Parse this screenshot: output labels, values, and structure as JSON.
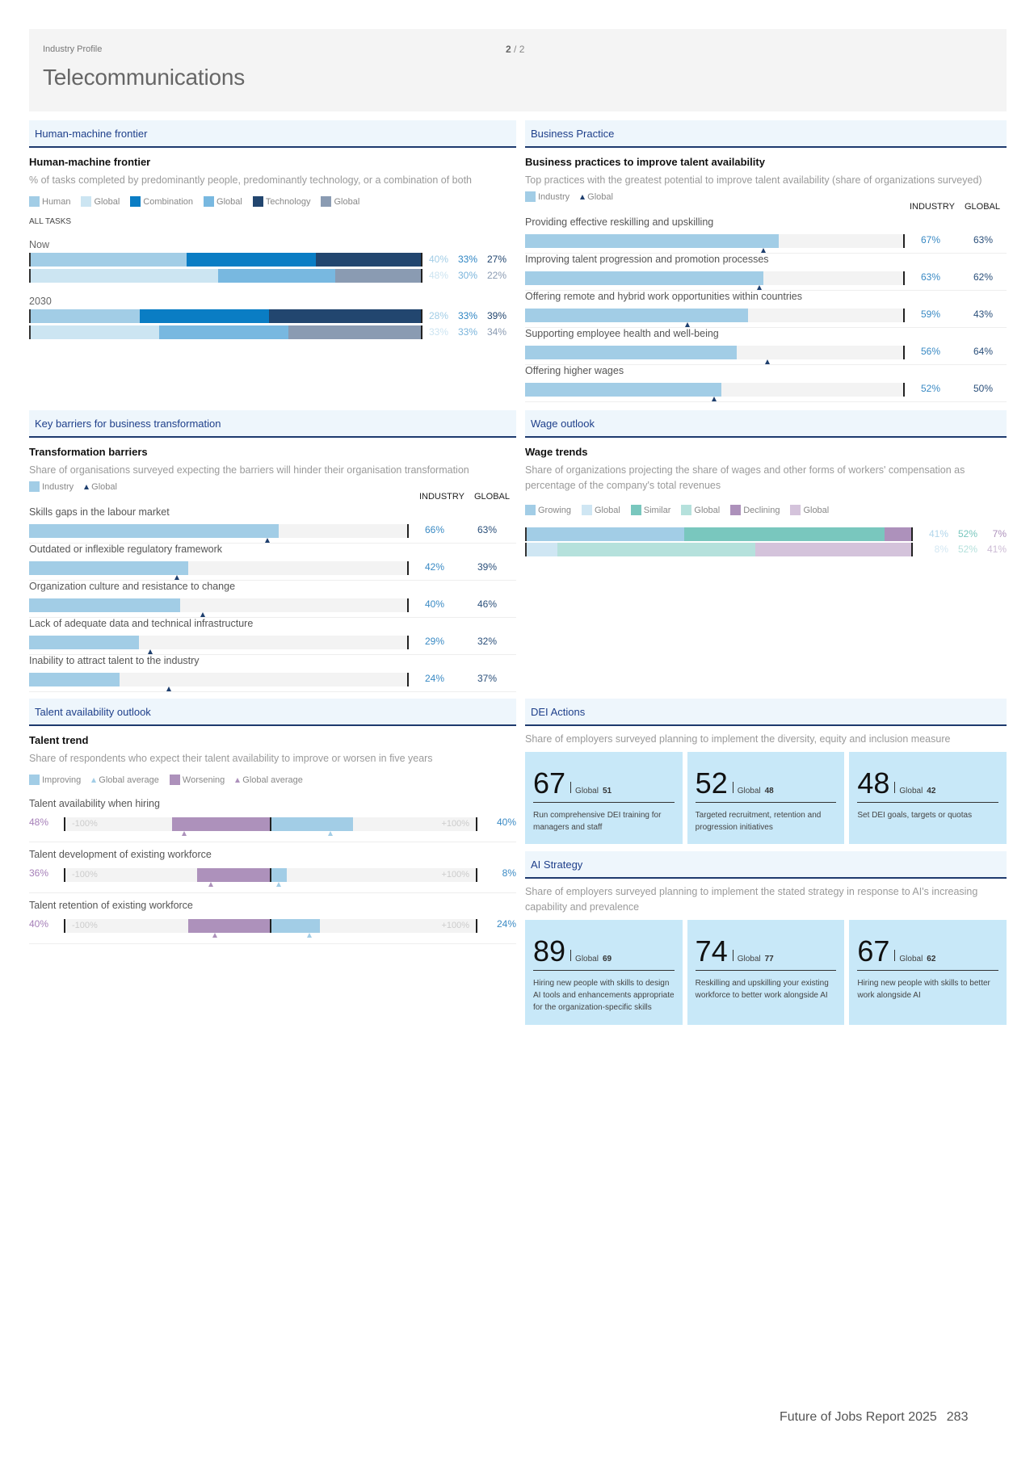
{
  "header": {
    "kicker": "Industry Profile",
    "page_current": "2",
    "page_sep": "/",
    "page_total": "2",
    "title": "Telecommunications"
  },
  "colors": {
    "human": "#a2cde6",
    "human_global": "#cce5f2",
    "combination": "#0a7dc4",
    "combination_global": "#78b8e0",
    "technology": "#22466f",
    "technology_global": "#8a9bb2",
    "growing": "#a2cde6",
    "growing_global": "#cfe6f3",
    "similar": "#79c7be",
    "similar_global": "#b5e1dc",
    "declining": "#ad91bb",
    "declining_global": "#d4c3db"
  },
  "hmf": {
    "section": "Human-machine frontier",
    "title": "Human-machine frontier",
    "desc": "% of tasks completed by predominantly people, predominantly technology, or a combination of both",
    "legend": [
      "Human",
      "Global",
      "Combination",
      "Global",
      "Technology",
      "Global"
    ],
    "tag": "ALL TASKS",
    "groups": [
      {
        "label": "Now",
        "industry": [
          40,
          33,
          27
        ],
        "global": [
          48,
          30,
          22
        ],
        "industry_text": [
          "40%",
          "33%",
          "27%"
        ],
        "global_text": [
          "48%",
          "30%",
          "22%"
        ]
      },
      {
        "label": "2030",
        "industry": [
          28,
          33,
          39
        ],
        "global": [
          33,
          33,
          34
        ],
        "industry_text": [
          "28%",
          "33%",
          "39%"
        ],
        "global_text": [
          "33%",
          "33%",
          "34%"
        ]
      }
    ]
  },
  "business": {
    "section": "Business Practice",
    "title": "Business practices to improve talent availability",
    "desc": "Top practices with the greatest potential to improve talent availability (share of organizations surveyed)",
    "legend_industry": "Industry",
    "legend_global": "Global",
    "col_industry": "INDUSTRY",
    "col_global": "GLOBAL",
    "items": [
      {
        "label": "Providing effective reskilling and upskilling",
        "industry": 67,
        "global": 63,
        "industry_text": "67%",
        "global_text": "63%"
      },
      {
        "label": "Improving talent progression and promotion processes",
        "industry": 63,
        "global": 62,
        "industry_text": "63%",
        "global_text": "62%"
      },
      {
        "label": "Offering remote and hybrid work opportunities within countries",
        "industry": 59,
        "global": 43,
        "industry_text": "59%",
        "global_text": "43%"
      },
      {
        "label": "Supporting employee health and well-being",
        "industry": 56,
        "global": 64,
        "industry_text": "56%",
        "global_text": "64%"
      },
      {
        "label": "Offering higher wages",
        "industry": 52,
        "global": 50,
        "industry_text": "52%",
        "global_text": "50%"
      }
    ]
  },
  "barriers": {
    "section": "Key barriers for business transformation",
    "title": "Transformation barriers",
    "desc": "Share of organisations surveyed expecting the barriers will hinder their organisation transformation",
    "legend_industry": "Industry",
    "legend_global": "Global",
    "col_industry": "INDUSTRY",
    "col_global": "GLOBAL",
    "items": [
      {
        "label": "Skills gaps in the labour market",
        "industry": 66,
        "global": 63,
        "industry_text": "66%",
        "global_text": "63%"
      },
      {
        "label": "Outdated or inflexible regulatory framework",
        "industry": 42,
        "global": 39,
        "industry_text": "42%",
        "global_text": "39%"
      },
      {
        "label": "Organization culture and resistance to change",
        "industry": 40,
        "global": 46,
        "industry_text": "40%",
        "global_text": "46%"
      },
      {
        "label": "Lack of adequate data and technical infrastructure",
        "industry": 29,
        "global": 32,
        "industry_text": "29%",
        "global_text": "32%"
      },
      {
        "label": "Inability to attract talent to the industry",
        "industry": 24,
        "global": 37,
        "industry_text": "24%",
        "global_text": "37%"
      }
    ]
  },
  "wage": {
    "section": "Wage outlook",
    "title": "Wage trends",
    "desc": "Share of organizations projecting the share of wages and other forms of workers' compensation as percentage of the company's total revenues",
    "legend": [
      "Growing",
      "Global",
      "Similar",
      "Global",
      "Declining",
      "Global"
    ],
    "industry": [
      41,
      52,
      7
    ],
    "global": [
      8,
      52,
      41
    ],
    "industry_text": [
      "41%",
      "52%",
      "7%"
    ],
    "global_text": [
      "8%",
      "52%",
      "41%"
    ]
  },
  "talent": {
    "section": "Talent availability outlook",
    "title": "Talent trend",
    "desc": "Share of respondents who expect their talent availability to improve or worsen in five years",
    "legend": [
      "Improving",
      "Global average",
      "Worsening",
      "Global average"
    ],
    "axis_min": "-100%",
    "axis_max": "+100%",
    "items": [
      {
        "label": "Talent availability when hiring",
        "worsening": 48,
        "improving": 40,
        "worsening_global": 42,
        "improving_global": 29,
        "worsening_text": "48%",
        "improving_text": "40%"
      },
      {
        "label": "Talent development of existing workforce",
        "worsening": 36,
        "improving": 8,
        "worsening_global": 29,
        "improving_global": 4,
        "worsening_text": "36%",
        "improving_text": "8%"
      },
      {
        "label": "Talent retention of existing workforce",
        "worsening": 40,
        "improving": 24,
        "worsening_global": 27,
        "improving_global": 19,
        "worsening_text": "40%",
        "improving_text": "24%"
      }
    ]
  },
  "dei": {
    "section": "DEI Actions",
    "desc": "Share of employers surveyed planning to implement the diversity, equity and inclusion measure",
    "global_label": "Global",
    "cards": [
      {
        "value": "67",
        "global": "51",
        "desc": "Run comprehensive DEI training for managers and staff"
      },
      {
        "value": "52",
        "global": "48",
        "desc": "Targeted recruitment, retention and progression initiatives"
      },
      {
        "value": "48",
        "global": "42",
        "desc": "Set DEI goals, targets or quotas"
      }
    ]
  },
  "ai": {
    "section": "AI Strategy",
    "desc": "Share of employers surveyed planning to implement the stated strategy in response to AI's increasing capability and prevalence",
    "global_label": "Global",
    "cards": [
      {
        "value": "89",
        "global": "69",
        "desc": "Hiring new people with skills to design AI tools and enhancements appropriate for the organization-specific skills"
      },
      {
        "value": "74",
        "global": "77",
        "desc": "Reskilling and upskilling your existing workforce to better work alongside AI"
      },
      {
        "value": "67",
        "global": "62",
        "desc": "Hiring new people with skills to better work alongside AI"
      }
    ]
  },
  "footer": {
    "report": "Future of Jobs Report 2025",
    "page_number": "283"
  },
  "chart_data": [
    {
      "type": "bar",
      "title": "Human-machine frontier",
      "stacked": true,
      "categories": [
        "Now - Industry",
        "Now - Global",
        "2030 - Industry",
        "2030 - Global"
      ],
      "series": [
        {
          "name": "Human",
          "values": [
            40,
            48,
            28,
            33
          ]
        },
        {
          "name": "Combination",
          "values": [
            33,
            30,
            33,
            33
          ]
        },
        {
          "name": "Technology",
          "values": [
            27,
            22,
            39,
            34
          ]
        }
      ],
      "xlim": [
        0,
        100
      ]
    },
    {
      "type": "bar",
      "title": "Business practices to improve talent availability",
      "categories": [
        "Providing effective reskilling and upskilling",
        "Improving talent progression and promotion processes",
        "Offering remote and hybrid work opportunities within countries",
        "Supporting employee health and well-being",
        "Offering higher wages"
      ],
      "series": [
        {
          "name": "Industry",
          "values": [
            67,
            63,
            59,
            56,
            52
          ]
        },
        {
          "name": "Global",
          "values": [
            63,
            62,
            43,
            64,
            50
          ]
        }
      ],
      "xlim": [
        0,
        100
      ]
    },
    {
      "type": "bar",
      "title": "Transformation barriers",
      "categories": [
        "Skills gaps in the labour market",
        "Outdated or inflexible regulatory framework",
        "Organization culture and resistance to change",
        "Lack of adequate data and technical infrastructure",
        "Inability to attract talent to the industry"
      ],
      "series": [
        {
          "name": "Industry",
          "values": [
            66,
            42,
            40,
            29,
            24
          ]
        },
        {
          "name": "Global",
          "values": [
            63,
            39,
            46,
            32,
            37
          ]
        }
      ],
      "xlim": [
        0,
        100
      ]
    },
    {
      "type": "bar",
      "title": "Wage trends",
      "stacked": true,
      "categories": [
        "Industry",
        "Global"
      ],
      "series": [
        {
          "name": "Growing",
          "values": [
            41,
            8
          ]
        },
        {
          "name": "Similar",
          "values": [
            52,
            52
          ]
        },
        {
          "name": "Declining",
          "values": [
            7,
            41
          ]
        }
      ],
      "xlim": [
        0,
        100
      ]
    },
    {
      "type": "bar",
      "title": "Talent trend",
      "diverging": true,
      "categories": [
        "Talent availability when hiring",
        "Talent development of existing workforce",
        "Talent retention of existing workforce"
      ],
      "series": [
        {
          "name": "Worsening",
          "values": [
            48,
            36,
            40
          ]
        },
        {
          "name": "Improving",
          "values": [
            40,
            8,
            24
          ]
        }
      ],
      "xlim": [
        -100,
        100
      ]
    }
  ]
}
